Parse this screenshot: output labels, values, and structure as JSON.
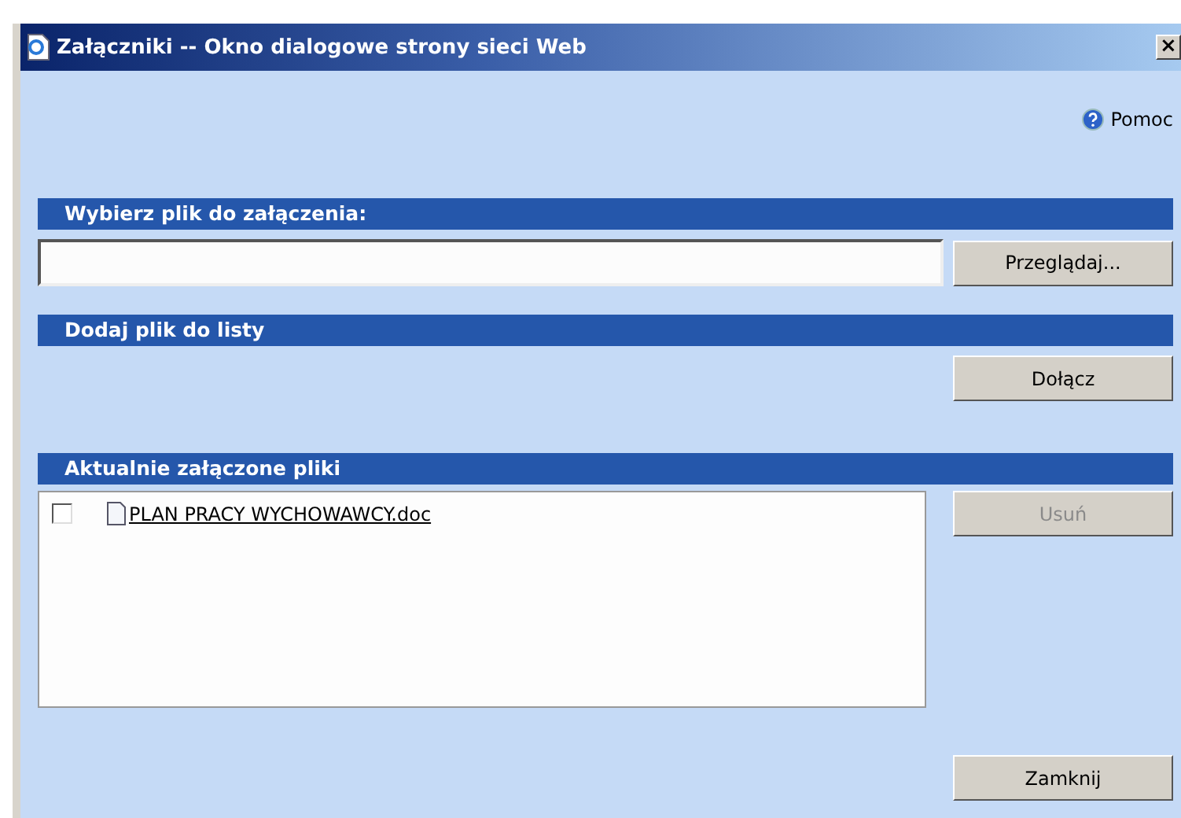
{
  "window": {
    "title": "Załączniki -- Okno dialogowe strony sieci Web",
    "close": "×"
  },
  "help": {
    "label": "Pomoc"
  },
  "sections": [
    {
      "title": "Wybierz plik do załączenia:"
    },
    {
      "title": "Dodaj plik do listy"
    },
    {
      "title": "Aktualnie załączone pliki"
    }
  ],
  "browse_button": {
    "label": "Przeglądaj...",
    "disabled": false
  },
  "attach_button": {
    "label": "Dołącz",
    "disabled": false
  },
  "files": [
    {
      "name": "PLAN PRACY WYCHOWAWCY.doc",
      "checked": false
    }
  ],
  "remove_button": {
    "label": "Usuń",
    "disabled": true
  },
  "close_button": {
    "label": "Zamknij",
    "disabled": false
  }
}
